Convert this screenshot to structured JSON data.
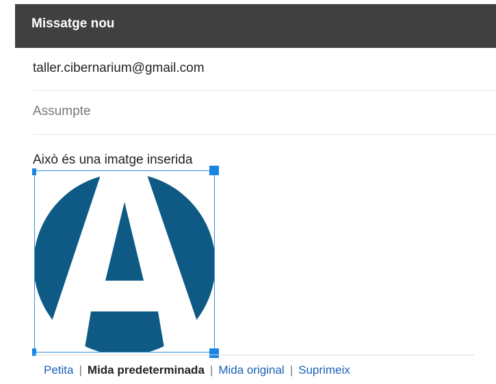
{
  "compose": {
    "title": "Missatge nou",
    "to_value": "taller.cibernarium@gmail.com",
    "subject_placeholder": "Assumpte",
    "subject_value": "",
    "body_text": "Això és una imatge inserida"
  },
  "image": {
    "icon": "letter-a-logo-icon",
    "color": "#0f5a85"
  },
  "size_options": {
    "small": "Petita",
    "default": "Mida predeterminada",
    "original": "Mida original",
    "remove": "Suprimeix",
    "separator": "|",
    "selected": "default"
  },
  "colors": {
    "header_bg": "#404040",
    "selection": "#1a85e0",
    "link": "#1a5fb4"
  }
}
